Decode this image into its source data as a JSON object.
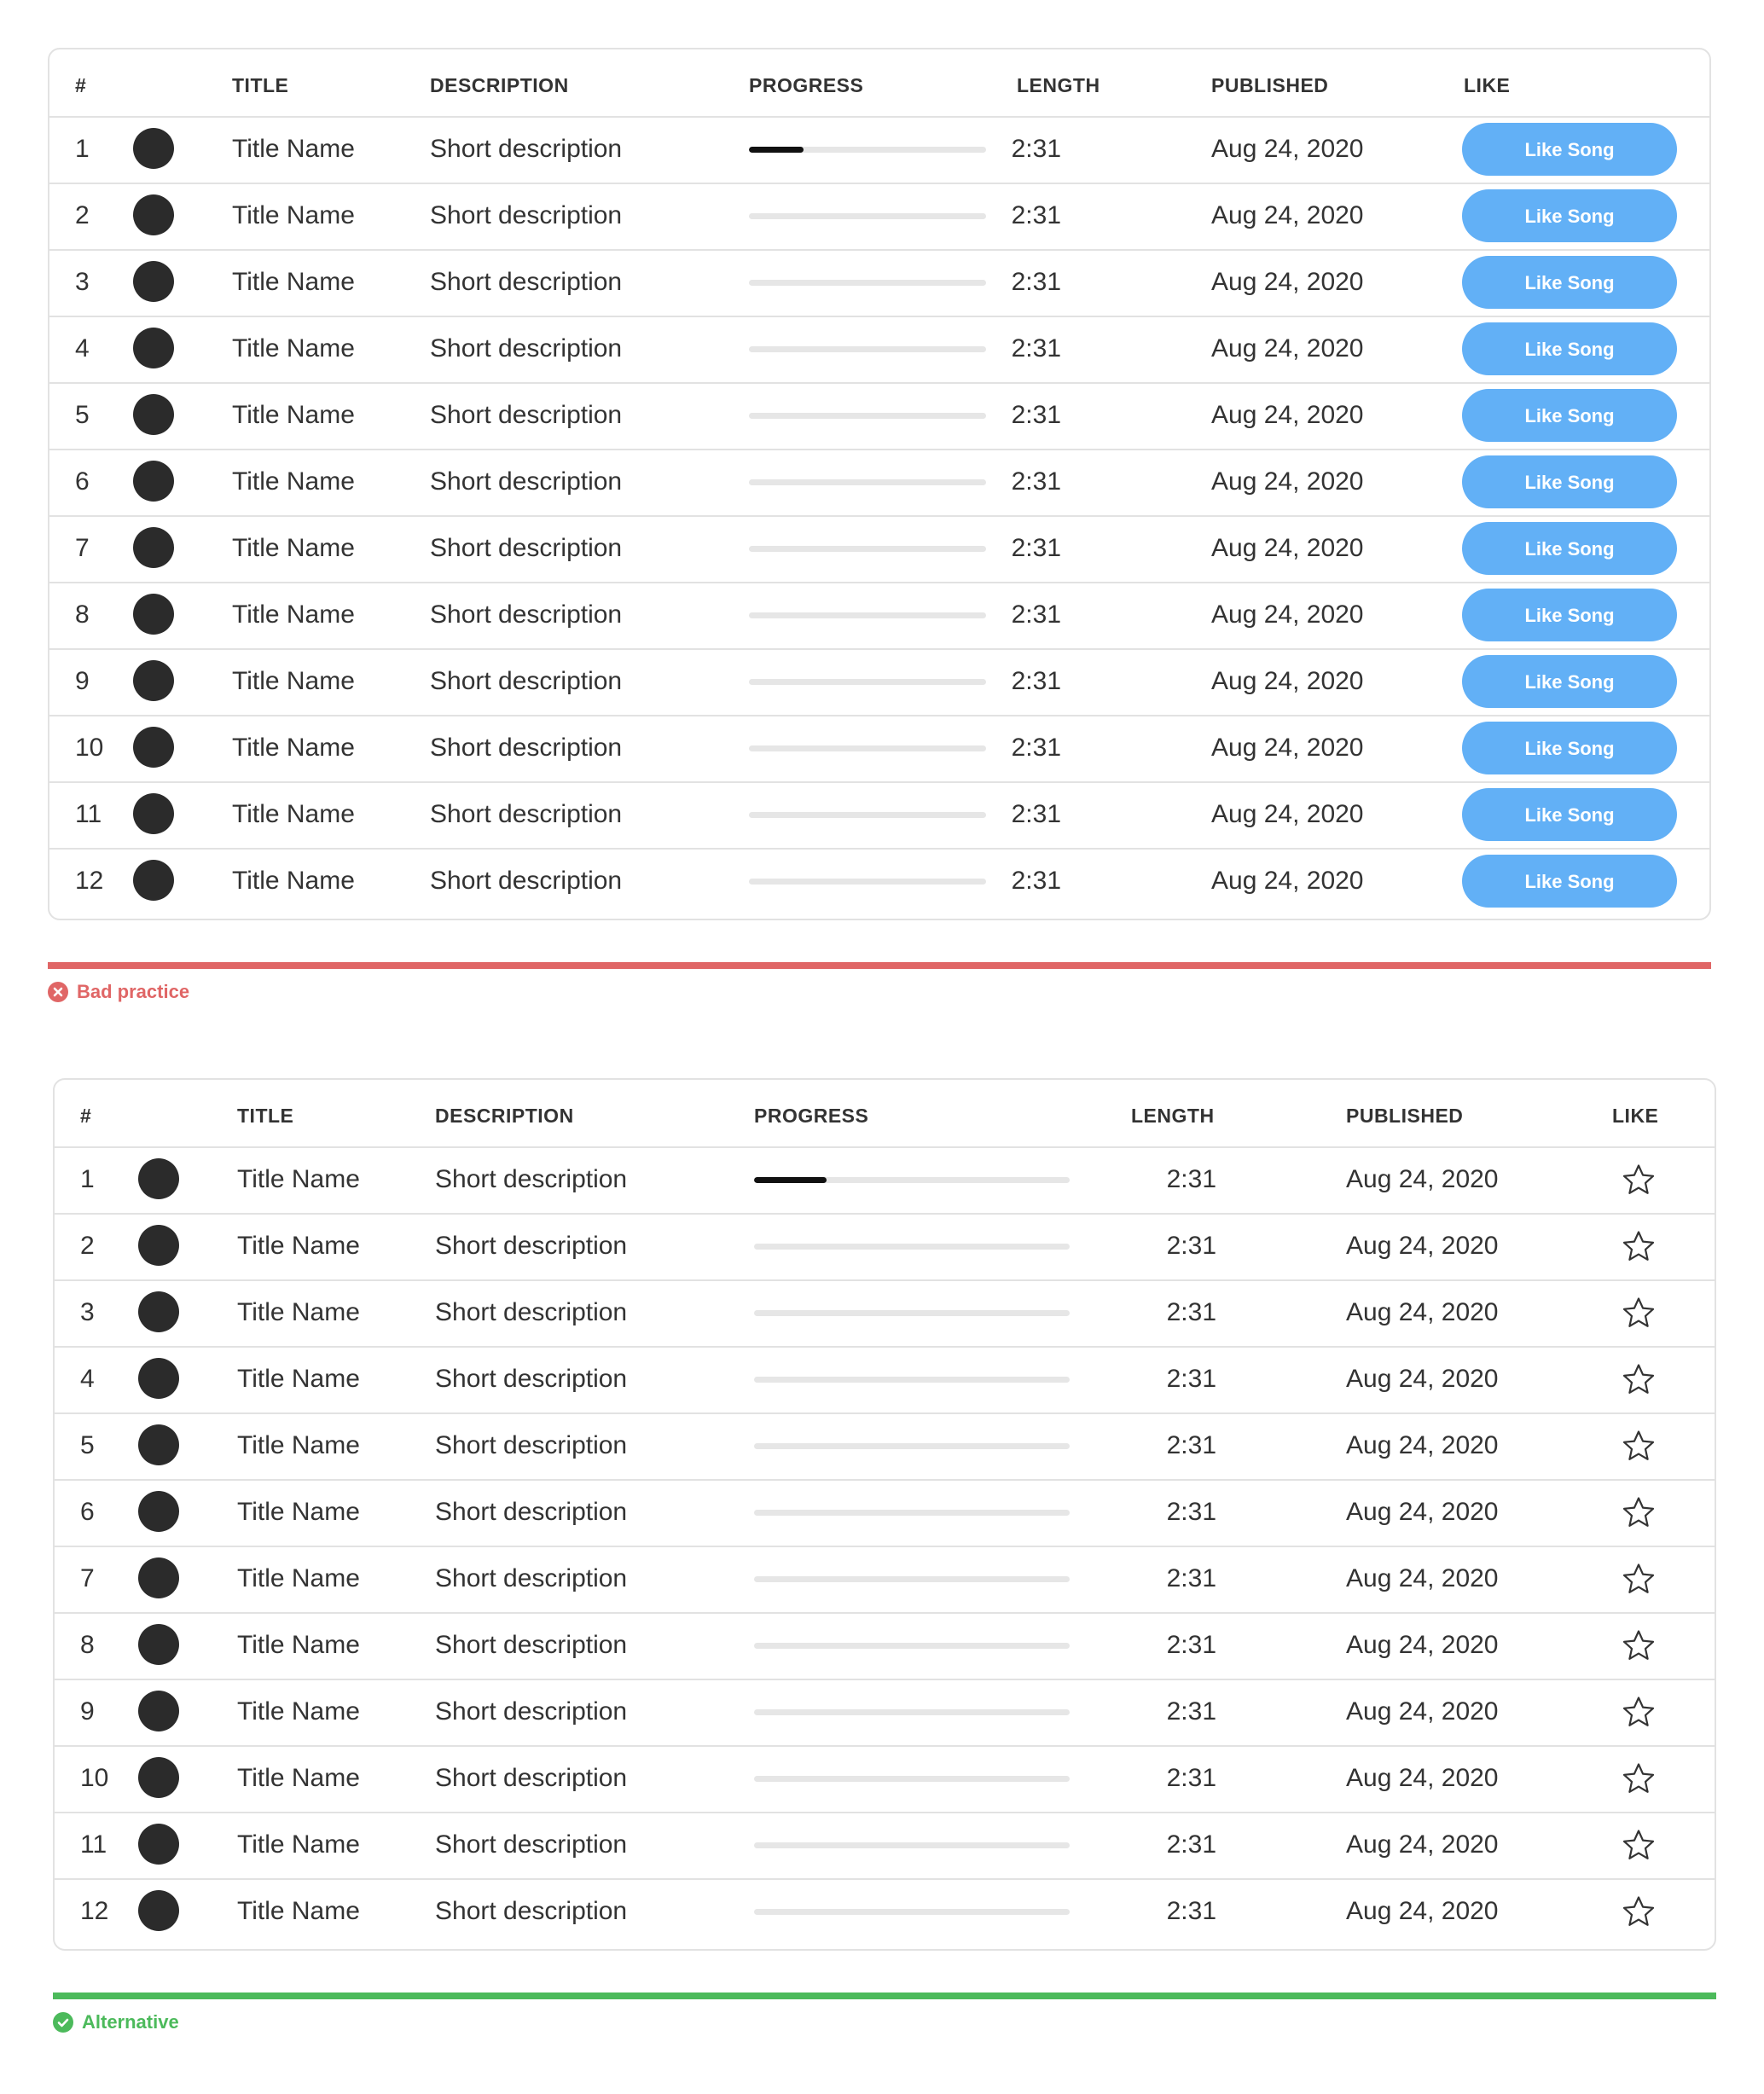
{
  "colors": {
    "like_button": "#62b0f6",
    "bad": "#e06666",
    "good": "#4cba5b",
    "progress_fill": "#111111",
    "progress_track": "#e6e6e6"
  },
  "headers": {
    "num": "#",
    "title": "TITLE",
    "description": "DESCRIPTION",
    "progress": "PROGRESS",
    "length": "LENGTH",
    "published": "PUBLISHED",
    "like": "LIKE"
  },
  "like_button_label": "Like Song",
  "star_icon": "star-outline-icon",
  "rows": [
    {
      "num": "1",
      "title": "Title Name",
      "description": "Short description",
      "progress": 0.23,
      "length": "2:31",
      "published": "Aug 24, 2020"
    },
    {
      "num": "2",
      "title": "Title Name",
      "description": "Short description",
      "progress": 0,
      "length": "2:31",
      "published": "Aug 24, 2020"
    },
    {
      "num": "3",
      "title": "Title Name",
      "description": "Short description",
      "progress": 0,
      "length": "2:31",
      "published": "Aug 24, 2020"
    },
    {
      "num": "4",
      "title": "Title Name",
      "description": "Short description",
      "progress": 0,
      "length": "2:31",
      "published": "Aug 24, 2020"
    },
    {
      "num": "5",
      "title": "Title Name",
      "description": "Short description",
      "progress": 0,
      "length": "2:31",
      "published": "Aug 24, 2020"
    },
    {
      "num": "6",
      "title": "Title Name",
      "description": "Short description",
      "progress": 0,
      "length": "2:31",
      "published": "Aug 24, 2020"
    },
    {
      "num": "7",
      "title": "Title Name",
      "description": "Short description",
      "progress": 0,
      "length": "2:31",
      "published": "Aug 24, 2020"
    },
    {
      "num": "8",
      "title": "Title Name",
      "description": "Short description",
      "progress": 0,
      "length": "2:31",
      "published": "Aug 24, 2020"
    },
    {
      "num": "9",
      "title": "Title Name",
      "description": "Short description",
      "progress": 0,
      "length": "2:31",
      "published": "Aug 24, 2020"
    },
    {
      "num": "10",
      "title": "Title Name",
      "description": "Short description",
      "progress": 0,
      "length": "2:31",
      "published": "Aug 24, 2020"
    },
    {
      "num": "11",
      "title": "Title Name",
      "description": "Short description",
      "progress": 0,
      "length": "2:31",
      "published": "Aug 24, 2020"
    },
    {
      "num": "12",
      "title": "Title Name",
      "description": "Short description",
      "progress": 0,
      "length": "2:31",
      "published": "Aug 24, 2020"
    }
  ],
  "bad_caption": "Bad practice",
  "bad_icon": "x-circle-icon",
  "good_caption": "Alternative",
  "good_icon": "check-circle-icon"
}
